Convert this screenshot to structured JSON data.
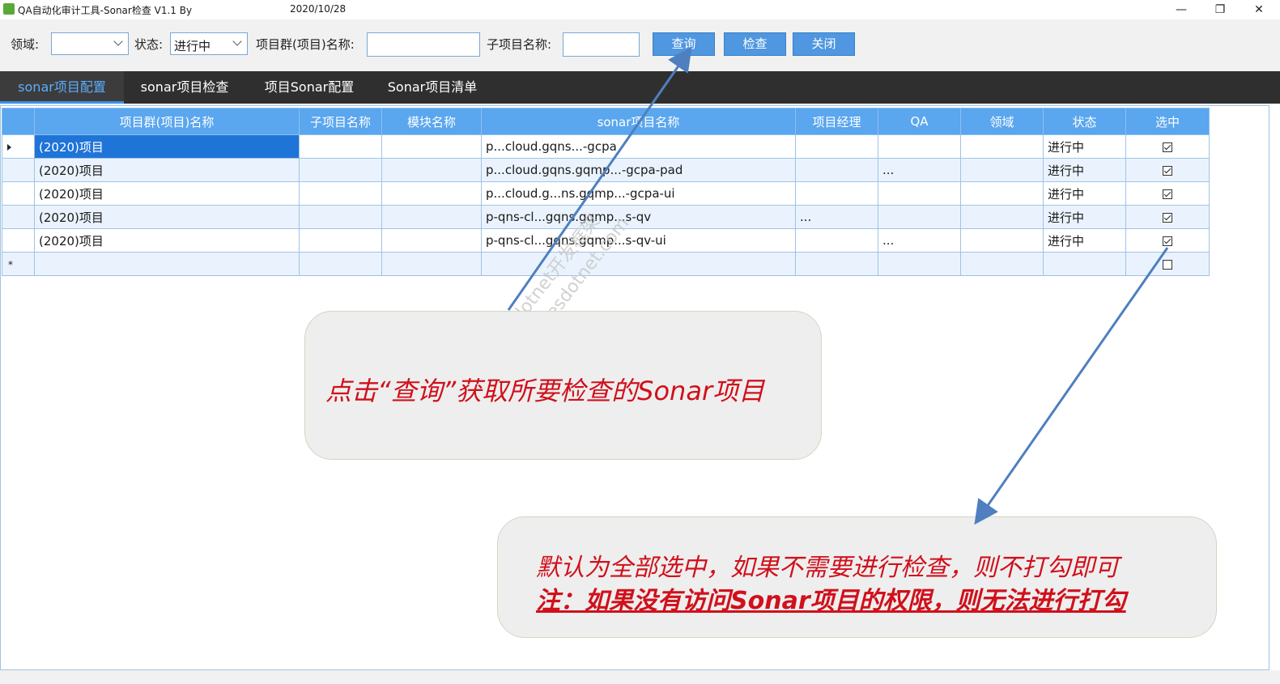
{
  "window": {
    "title": "QA自动化审计工具-Sonar检查 V1.1  By",
    "date": "2020/10/28",
    "minimize_glyph": "—",
    "maximize_glyph": "❐",
    "close_glyph": "✕"
  },
  "toolbar": {
    "domain_label": "领域:",
    "domain_value": "",
    "status_label": "状态:",
    "status_value": "进行中",
    "project_group_label": "项目群(项目)名称:",
    "project_group_value": "",
    "subproject_label": "子项目名称:",
    "subproject_value": "",
    "query_button": "查询",
    "check_button": "检查",
    "close_button": "关闭"
  },
  "tabs": [
    "sonar项目配置",
    "sonar项目检查",
    "项目Sonar配置",
    "Sonar项目清单"
  ],
  "grid": {
    "columns": [
      "项目群(项目)名称",
      "子项目名称",
      "模块名称",
      "sonar项目名称",
      "项目经理",
      "QA",
      "领域",
      "状态",
      "选中"
    ],
    "rows": [
      {
        "project_group": "(2020)项目",
        "subproject": "",
        "module": "",
        "sonar_project": "p...cloud.gqns...-gcpa",
        "manager": "",
        "qa": "",
        "domain": "",
        "status": "进行中",
        "selected": true
      },
      {
        "project_group": "(2020)项目",
        "subproject": "",
        "module": "",
        "sonar_project": "p...cloud.gqns.gqmp...-gcpa-pad",
        "manager": "",
        "qa": "...",
        "domain": "",
        "status": "进行中",
        "selected": true
      },
      {
        "project_group": "(2020)项目",
        "subproject": "",
        "module": "",
        "sonar_project": "p...cloud.g...ns.gqmp...-gcpa-ui",
        "manager": "",
        "qa": "",
        "domain": "",
        "status": "进行中",
        "selected": true
      },
      {
        "project_group": "(2020)项目",
        "subproject": "",
        "module": "",
        "sonar_project": "p-qns-cl...gqns.gqmp...s-qv",
        "manager": "...",
        "qa": "",
        "domain": "",
        "status": "进行中",
        "selected": true
      },
      {
        "project_group": "(2020)项目",
        "subproject": "",
        "module": "",
        "sonar_project": "p-qns-cl...gqns.gqmp...s-qv-ui",
        "manager": "",
        "qa": "...",
        "domain": "",
        "status": "进行中",
        "selected": true
      }
    ],
    "new_row_marker": "*"
  },
  "annotations": {
    "callout1": "点击“查询”获取所要检查的Sonar项目",
    "callout2_line1": "默认为全部选中，如果不需要进行检查，则不打勾即可",
    "callout2_line2": "注：如果没有访问Sonar项目的权限，则无法进行打勾"
  },
  "watermark": {
    "line1": "Yes dotnet开发框架",
    "line2": "www.yesdotnet.com"
  },
  "colors": {
    "accent": "#4f97e0",
    "tabbar": "#2f2f2f",
    "header": "#5aa6ef",
    "annotation_text": "#d0101b",
    "arrow": "#4f7fbf"
  }
}
